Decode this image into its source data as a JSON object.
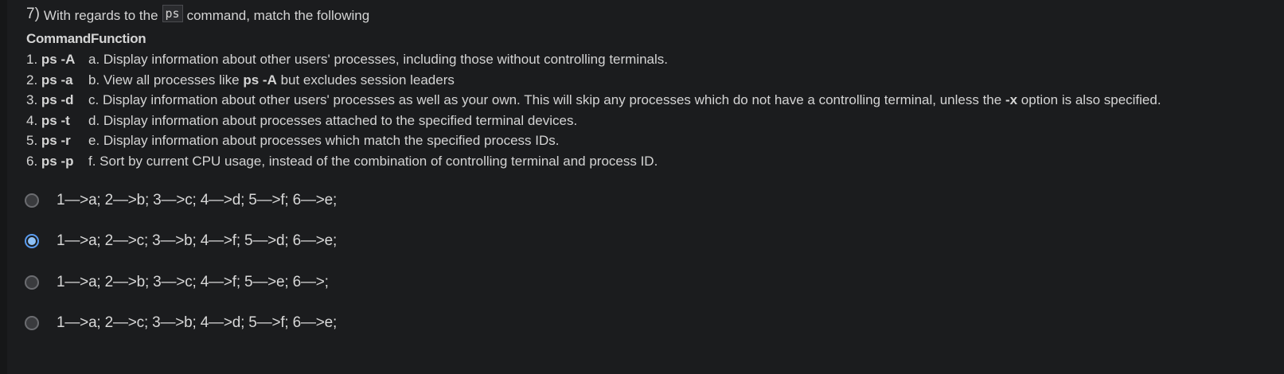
{
  "question": {
    "number": "7)",
    "prefix": "With regards to the",
    "code": "ps",
    "suffix": "command, match the following",
    "header": "CommandFunction"
  },
  "commands": [
    {
      "num": "1.",
      "cmd": "ps -A"
    },
    {
      "num": "2.",
      "cmd": "ps -a"
    },
    {
      "num": "3.",
      "cmd": "ps -d"
    },
    {
      "num": "4.",
      "cmd": "ps -t"
    },
    {
      "num": "5.",
      "cmd": "ps -r"
    },
    {
      "num": "6.",
      "cmd": "ps -p"
    }
  ],
  "functions": {
    "a": "a. Display information about other users' processes, including those without controlling terminals.",
    "b_pre": "b. View all processes like",
    "b_bold": "ps -A",
    "b_post": "but excludes session leaders",
    "c_pre": "c. Display information about other users' processes as well as your own. This will skip any processes which do not have a controlling terminal, unless the",
    "c_bold": "-x",
    "c_post": "option is also specified.",
    "d": "d. Display information about processes attached to the specified terminal devices.",
    "e": "e. Display information about processes which match the specified process IDs.",
    "f": "f. Sort by current CPU usage, instead of the combination of controlling terminal and process ID."
  },
  "options": [
    {
      "label": "1—>a; 2—>b; 3—>c; 4—>d; 5—>f; 6—>e;",
      "selected": false
    },
    {
      "label": "1—>a; 2—>c; 3—>b; 4—>f; 5—>d; 6—>e;",
      "selected": true
    },
    {
      "label": "1—>a; 2—>b; 3—>c; 4—>f; 5—>e; 6—>;",
      "selected": false
    },
    {
      "label": "1—>a; 2—>c; 3—>b; 4—>d; 5—>f; 6—>e;",
      "selected": false
    }
  ],
  "colors": {
    "background": "#1b1c1e",
    "text": "#d4d4d4",
    "radio_selected": "#5a9cf0"
  }
}
